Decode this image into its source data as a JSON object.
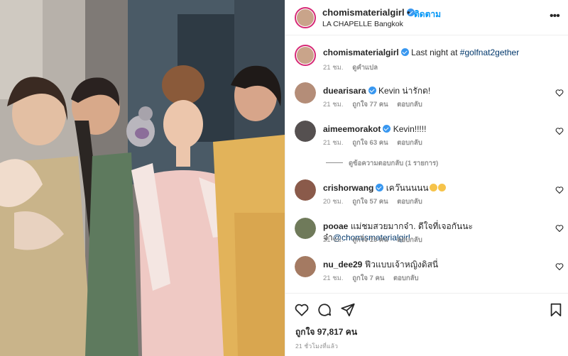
{
  "post": {
    "username": "chomismaterialgirl",
    "dot": "•",
    "follow_label": "ติดตาม",
    "location": "LA CHAPELLE Bangkok",
    "more_icon": "more-horizontal-icon"
  },
  "caption": {
    "username": "chomismaterialgirl",
    "text": "Last night at ",
    "hashtag": "#golfnat2gether",
    "time": "21 ชม.",
    "translate": "ดูคำแปล"
  },
  "comments": [
    {
      "username": "duearisara",
      "verified": true,
      "text": "Kevin น่ารักด!",
      "time": "21 ชม.",
      "likes": "ถูกใจ 77 คน",
      "reply": "ตอบกลับ"
    },
    {
      "username": "aimeemorakot",
      "verified": true,
      "text": "Kevin!!!!!",
      "time": "21 ชม.",
      "likes": "ถูกใจ 63 คน",
      "reply": "ตอบกลับ"
    },
    {
      "username": "crishorwang",
      "verified": true,
      "text": "เคว๊นนนนน",
      "time": "20 ชม.",
      "likes": "ถูกใจ 57 คน",
      "reply": "ตอบกลับ"
    },
    {
      "username": "pooae",
      "verified": false,
      "text": "แม่ชมสวยมากจ๋า. ดีใจที่เจอกันนะจ๋า",
      "mention": "@chomismaterialgirl",
      "time": "21 ชม.",
      "likes": "ถูกใจ 15 คน",
      "reply": "ตอบกลับ"
    },
    {
      "username": "nu_dee29",
      "verified": false,
      "text": "ฟีวแบบเจ้าหญิงดิสนี่",
      "time": "21 ชม.",
      "likes": "ถูกใจ 7 คน",
      "reply": "ตอบกลับ"
    }
  ],
  "view_replies": "ดูข้อความตอบกลับ (1 รายการ)",
  "actions": {
    "like_icon": "heart-icon",
    "comment_icon": "comment-icon",
    "share_icon": "send-icon",
    "save_icon": "bookmark-icon"
  },
  "likes_text": "ถูกใจ 97,817 คน",
  "time_ago": "21 ชั่วโมงที่แล้ว",
  "colors": {
    "link": "#00376b",
    "follow": "#0095f6",
    "verified": "#3897f0",
    "muted": "#8e8e8e",
    "text": "#262626"
  }
}
